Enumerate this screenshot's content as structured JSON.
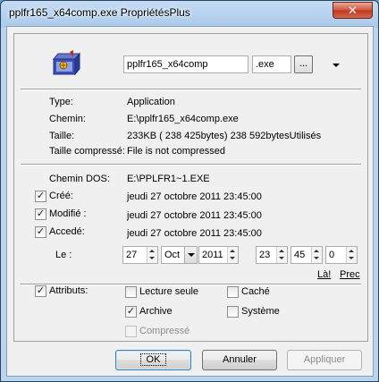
{
  "window": {
    "title": "pplfr165_x64comp.exe PropriétésPlus",
    "close_glyph": "✕"
  },
  "file": {
    "name": "pplfr165_x64comp",
    "extension": ".exe",
    "browse_label": "...",
    "icon": "executable-file-icon"
  },
  "info": {
    "type_label": "Type:",
    "type_value": "Application",
    "path_label": "Chemin:",
    "path_value": "E:\\pplfr165_x64comp.exe",
    "size_label": "Taille:",
    "size_value": "233KB ( 238 425bytes) 238 592bytesUtilisés",
    "compressed_size_label": "Taille compressé:",
    "compressed_size_value": "File is not compressed",
    "dos_path_label": "Chemin DOS:",
    "dos_path_value": "E:\\PPLFR1~1.EXE"
  },
  "dates": {
    "created_label": "Créé:",
    "created_value": "jeudi 27 octobre 2011 23:45:00",
    "created_checked": true,
    "modified_label": "Modifié :",
    "modified_value": "jeudi 27 octobre 2011 23:45:00",
    "modified_checked": true,
    "accessed_label": "Accedé:",
    "accessed_value": "jeudi 27 octobre 2011 23:45:00",
    "accessed_checked": true
  },
  "le": {
    "label": "Le :",
    "day": "27",
    "month": "Oct",
    "year": "2011",
    "hour": "23",
    "minute": "45",
    "second": "0",
    "now_link": "Là!",
    "prev_link": "Prec"
  },
  "attributes": {
    "label": "Attributs:",
    "checked": true,
    "readonly_label": "Lecture seule",
    "readonly_checked": false,
    "hidden_label": "Caché",
    "hidden_checked": false,
    "archive_label": "Archive",
    "archive_checked": true,
    "system_label": "Système",
    "system_checked": false,
    "compressed_label": "Compressé",
    "compressed_checked": false
  },
  "buttons": {
    "ok": "OK",
    "cancel": "Annuler",
    "apply": "Appliquer"
  },
  "check_glyph": "✓"
}
